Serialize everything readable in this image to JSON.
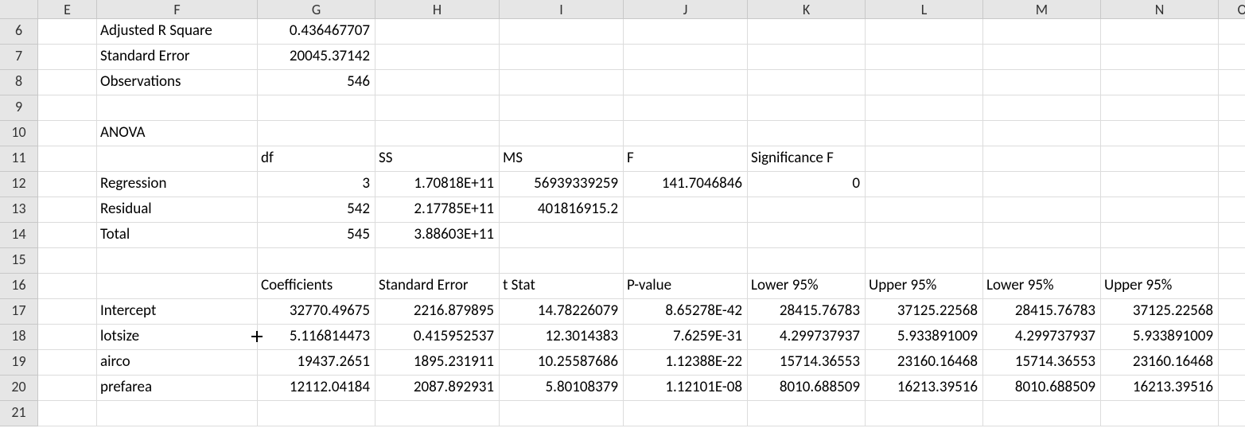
{
  "columns": [
    "",
    "E",
    "F",
    "G",
    "H",
    "I",
    "J",
    "K",
    "L",
    "M",
    "N",
    "O"
  ],
  "rows": [
    {
      "n": "6",
      "cells": [
        {
          "t": ""
        },
        {
          "t": "Adjusted R Square",
          "a": "txt"
        },
        {
          "t": "0.436467707",
          "a": "num"
        },
        {
          "t": ""
        },
        {
          "t": ""
        },
        {
          "t": ""
        },
        {
          "t": ""
        },
        {
          "t": ""
        },
        {
          "t": ""
        },
        {
          "t": ""
        },
        {
          "t": ""
        }
      ]
    },
    {
      "n": "7",
      "cells": [
        {
          "t": ""
        },
        {
          "t": "Standard Error",
          "a": "txt"
        },
        {
          "t": "20045.37142",
          "a": "num"
        },
        {
          "t": ""
        },
        {
          "t": ""
        },
        {
          "t": ""
        },
        {
          "t": ""
        },
        {
          "t": ""
        },
        {
          "t": ""
        },
        {
          "t": ""
        },
        {
          "t": ""
        }
      ]
    },
    {
      "n": "8",
      "cells": [
        {
          "t": ""
        },
        {
          "t": "Observations",
          "a": "txt"
        },
        {
          "t": "546",
          "a": "num"
        },
        {
          "t": ""
        },
        {
          "t": ""
        },
        {
          "t": ""
        },
        {
          "t": ""
        },
        {
          "t": ""
        },
        {
          "t": ""
        },
        {
          "t": ""
        },
        {
          "t": ""
        }
      ]
    },
    {
      "n": "9",
      "cells": [
        {
          "t": ""
        },
        {
          "t": ""
        },
        {
          "t": ""
        },
        {
          "t": ""
        },
        {
          "t": ""
        },
        {
          "t": ""
        },
        {
          "t": ""
        },
        {
          "t": ""
        },
        {
          "t": ""
        },
        {
          "t": ""
        },
        {
          "t": ""
        }
      ]
    },
    {
      "n": "10",
      "cells": [
        {
          "t": ""
        },
        {
          "t": "ANOVA",
          "a": "txt"
        },
        {
          "t": ""
        },
        {
          "t": ""
        },
        {
          "t": ""
        },
        {
          "t": ""
        },
        {
          "t": ""
        },
        {
          "t": ""
        },
        {
          "t": ""
        },
        {
          "t": ""
        },
        {
          "t": ""
        }
      ]
    },
    {
      "n": "11",
      "cells": [
        {
          "t": ""
        },
        {
          "t": ""
        },
        {
          "t": "df",
          "a": "txt"
        },
        {
          "t": "SS",
          "a": "txt"
        },
        {
          "t": "MS",
          "a": "txt"
        },
        {
          "t": "F",
          "a": "txt"
        },
        {
          "t": "Significance F",
          "a": "txt"
        },
        {
          "t": ""
        },
        {
          "t": ""
        },
        {
          "t": ""
        },
        {
          "t": ""
        }
      ]
    },
    {
      "n": "12",
      "cells": [
        {
          "t": ""
        },
        {
          "t": "Regression",
          "a": "txt"
        },
        {
          "t": "3",
          "a": "num"
        },
        {
          "t": "1.70818E+11",
          "a": "num"
        },
        {
          "t": "56939339259",
          "a": "num"
        },
        {
          "t": "141.7046846",
          "a": "num"
        },
        {
          "t": "0",
          "a": "num"
        },
        {
          "t": ""
        },
        {
          "t": ""
        },
        {
          "t": ""
        },
        {
          "t": ""
        }
      ]
    },
    {
      "n": "13",
      "cells": [
        {
          "t": ""
        },
        {
          "t": "Residual",
          "a": "txt"
        },
        {
          "t": "542",
          "a": "num"
        },
        {
          "t": "2.17785E+11",
          "a": "num"
        },
        {
          "t": "401816915.2",
          "a": "num"
        },
        {
          "t": ""
        },
        {
          "t": ""
        },
        {
          "t": ""
        },
        {
          "t": ""
        },
        {
          "t": ""
        },
        {
          "t": ""
        }
      ]
    },
    {
      "n": "14",
      "cells": [
        {
          "t": ""
        },
        {
          "t": "Total",
          "a": "txt"
        },
        {
          "t": "545",
          "a": "num"
        },
        {
          "t": "3.88603E+11",
          "a": "num"
        },
        {
          "t": ""
        },
        {
          "t": ""
        },
        {
          "t": ""
        },
        {
          "t": ""
        },
        {
          "t": ""
        },
        {
          "t": ""
        },
        {
          "t": ""
        }
      ]
    },
    {
      "n": "15",
      "cells": [
        {
          "t": ""
        },
        {
          "t": ""
        },
        {
          "t": ""
        },
        {
          "t": ""
        },
        {
          "t": ""
        },
        {
          "t": ""
        },
        {
          "t": ""
        },
        {
          "t": ""
        },
        {
          "t": ""
        },
        {
          "t": ""
        },
        {
          "t": ""
        }
      ]
    },
    {
      "n": "16",
      "cells": [
        {
          "t": ""
        },
        {
          "t": ""
        },
        {
          "t": "Coefficients",
          "a": "txt"
        },
        {
          "t": "Standard Error",
          "a": "txt"
        },
        {
          "t": "t Stat",
          "a": "txt"
        },
        {
          "t": "P-value",
          "a": "txt"
        },
        {
          "t": "Lower 95%",
          "a": "txt"
        },
        {
          "t": "Upper 95%",
          "a": "txt"
        },
        {
          "t": "Lower 95%",
          "a": "txt"
        },
        {
          "t": "Upper 95%",
          "a": "txt"
        },
        {
          "t": ""
        }
      ]
    },
    {
      "n": "17",
      "cells": [
        {
          "t": ""
        },
        {
          "t": "Intercept",
          "a": "txt"
        },
        {
          "t": "32770.49675",
          "a": "num"
        },
        {
          "t": "2216.879895",
          "a": "num"
        },
        {
          "t": "14.78226079",
          "a": "num"
        },
        {
          "t": "8.65278E-42",
          "a": "num"
        },
        {
          "t": "28415.76783",
          "a": "num"
        },
        {
          "t": "37125.22568",
          "a": "num"
        },
        {
          "t": "28415.76783",
          "a": "num"
        },
        {
          "t": "37125.22568",
          "a": "num"
        },
        {
          "t": ""
        }
      ]
    },
    {
      "n": "18",
      "cells": [
        {
          "t": ""
        },
        {
          "t": "lotsize",
          "a": "txt"
        },
        {
          "t": "5.116814473",
          "a": "num",
          "cursor": true
        },
        {
          "t": "0.415952537",
          "a": "num"
        },
        {
          "t": "12.3014383",
          "a": "num"
        },
        {
          "t": "7.6259E-31",
          "a": "num"
        },
        {
          "t": "4.299737937",
          "a": "num"
        },
        {
          "t": "5.933891009",
          "a": "num"
        },
        {
          "t": "4.299737937",
          "a": "num"
        },
        {
          "t": "5.933891009",
          "a": "num"
        },
        {
          "t": ""
        }
      ]
    },
    {
      "n": "19",
      "cells": [
        {
          "t": ""
        },
        {
          "t": "airco",
          "a": "txt"
        },
        {
          "t": "19437.2651",
          "a": "num"
        },
        {
          "t": "1895.231911",
          "a": "num"
        },
        {
          "t": "10.25587686",
          "a": "num"
        },
        {
          "t": "1.12388E-22",
          "a": "num"
        },
        {
          "t": "15714.36553",
          "a": "num"
        },
        {
          "t": "23160.16468",
          "a": "num"
        },
        {
          "t": "15714.36553",
          "a": "num"
        },
        {
          "t": "23160.16468",
          "a": "num"
        },
        {
          "t": ""
        }
      ]
    },
    {
      "n": "20",
      "cells": [
        {
          "t": ""
        },
        {
          "t": "prefarea",
          "a": "txt"
        },
        {
          "t": "12112.04184",
          "a": "num"
        },
        {
          "t": "2087.892931",
          "a": "num"
        },
        {
          "t": "5.80108379",
          "a": "num"
        },
        {
          "t": "1.12101E-08",
          "a": "num"
        },
        {
          "t": "8010.688509",
          "a": "num"
        },
        {
          "t": "16213.39516",
          "a": "num"
        },
        {
          "t": "8010.688509",
          "a": "num"
        },
        {
          "t": "16213.39516",
          "a": "num"
        },
        {
          "t": ""
        }
      ]
    },
    {
      "n": "21",
      "cells": [
        {
          "t": ""
        },
        {
          "t": ""
        },
        {
          "t": ""
        },
        {
          "t": ""
        },
        {
          "t": ""
        },
        {
          "t": ""
        },
        {
          "t": ""
        },
        {
          "t": ""
        },
        {
          "t": ""
        },
        {
          "t": ""
        },
        {
          "t": ""
        }
      ]
    }
  ]
}
